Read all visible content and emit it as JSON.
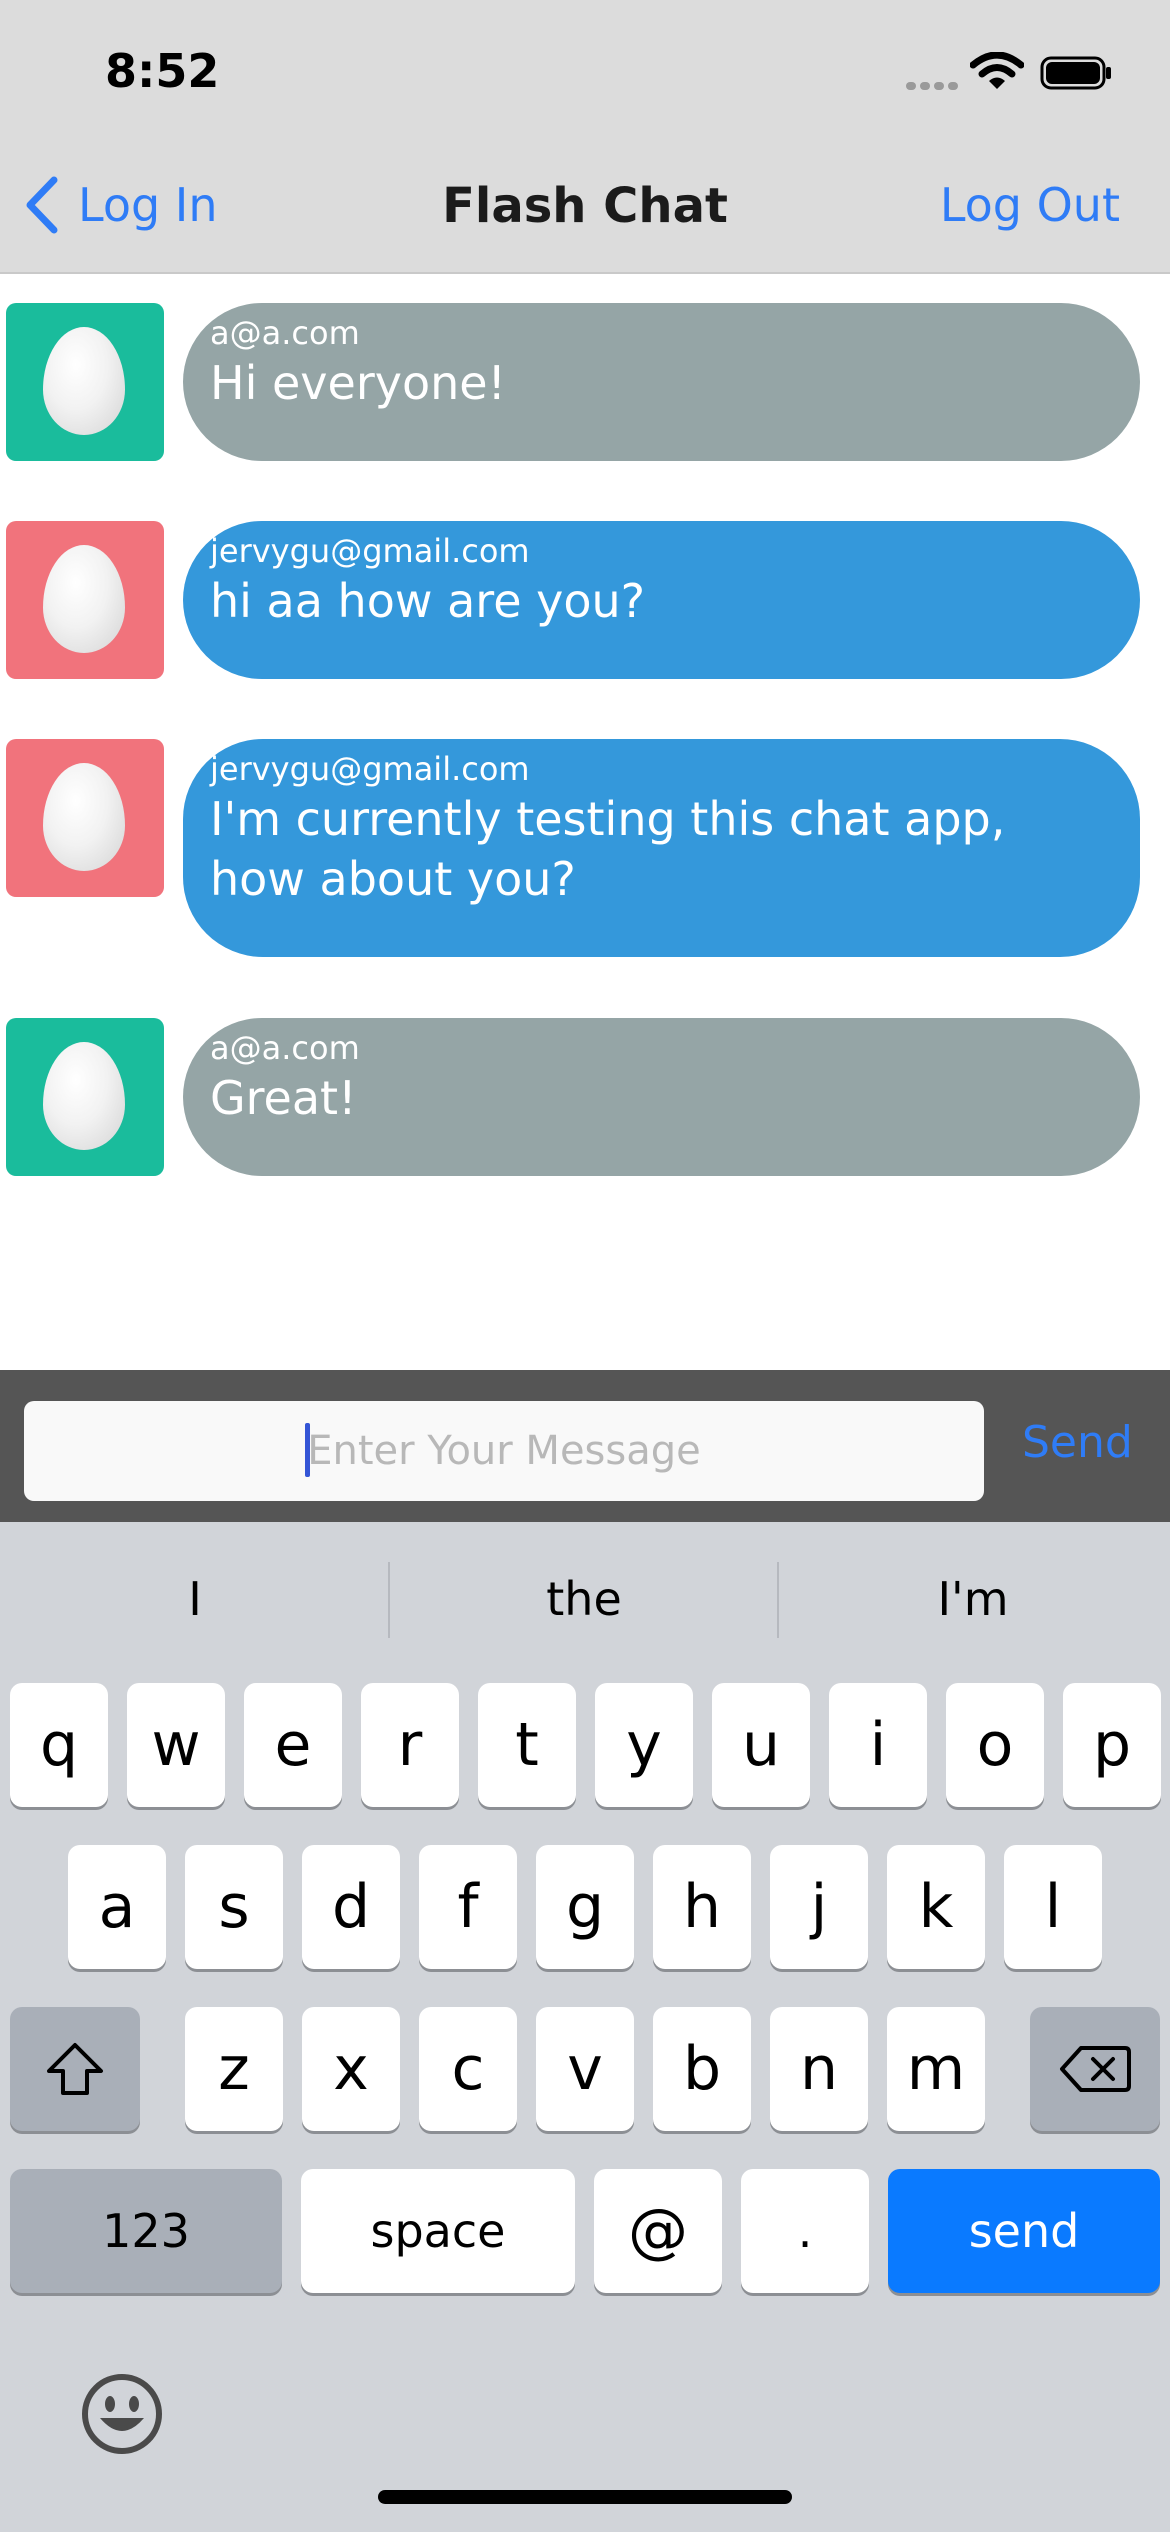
{
  "status": {
    "time": "8:52"
  },
  "nav": {
    "back_label": "Log In",
    "title": "Flash Chat",
    "logout_label": "Log Out"
  },
  "colors": {
    "accent": "#2f7cf6",
    "incoming_bubble": "#3498db",
    "own_bubble": "#95a5a6",
    "avatar_teal": "#1abc9c",
    "avatar_pink": "#f1737c"
  },
  "messages": [
    {
      "sender": "a@a.com",
      "text": "Hi everyone!",
      "avatar_icon": "egg-icon"
    },
    {
      "sender": "jervygu@gmail.com",
      "text": "hi aa how are you?",
      "avatar_icon": "egg-icon"
    },
    {
      "sender": "jervygu@gmail.com",
      "text": "I'm currently testing this chat app, how about you?",
      "avatar_icon": "egg-icon"
    },
    {
      "sender": "a@a.com",
      "text": "Great!",
      "avatar_icon": "egg-icon"
    }
  ],
  "composer": {
    "placeholder": "Enter Your Message",
    "send_label": "Send"
  },
  "keyboard": {
    "suggestions": [
      "I",
      "the",
      "I'm"
    ],
    "row1": [
      "q",
      "w",
      "e",
      "r",
      "t",
      "y",
      "u",
      "i",
      "o",
      "p"
    ],
    "row2": [
      "a",
      "s",
      "d",
      "f",
      "g",
      "h",
      "j",
      "k",
      "l"
    ],
    "row3": [
      "z",
      "x",
      "c",
      "v",
      "b",
      "n",
      "m"
    ],
    "numbers_label": "123",
    "space_label": "space",
    "at_label": "@",
    "dot_label": ".",
    "send_label": "send"
  }
}
